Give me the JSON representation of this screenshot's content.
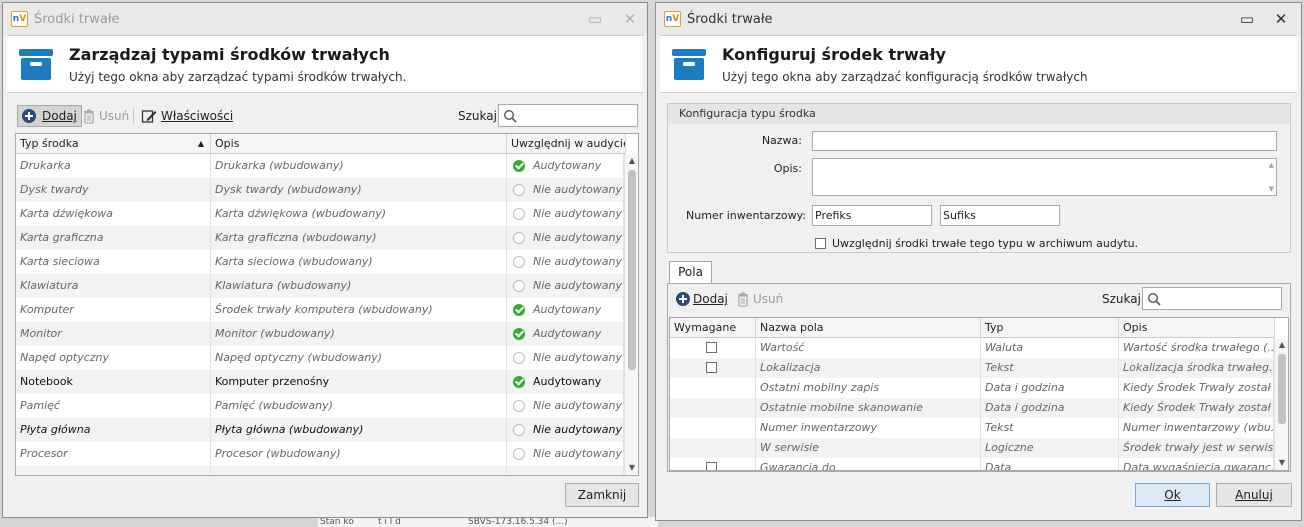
{
  "background": {
    "strip_texts": [
      "Stan ko",
      "t i l d",
      "SBVS-173.16.5.34 (...)"
    ]
  },
  "left_window": {
    "title": "Środki trwałe",
    "controls": {
      "maximize": "▭",
      "close": "✕"
    },
    "header": {
      "title": "Zarządzaj typami środków trwałych",
      "subtitle": "Użyj tego okna aby zarządzać typami środków trwałych."
    },
    "toolbar": {
      "add_label": "Dodaj",
      "remove_label": "Usuń",
      "properties_label": "Właściwości",
      "search_label": "Szukaj"
    },
    "grid": {
      "columns": [
        "Typ środka",
        "Opis",
        "Uwzględnij w audycie"
      ],
      "sort_indicator": "▲",
      "rows": [
        {
          "type": "Drukarka",
          "desc": "Drukarka (wbudowany)",
          "audit": "Audytowany",
          "audited": true,
          "style": "it"
        },
        {
          "type": "Dysk twardy",
          "desc": "Dysk twardy (wbudowany)",
          "audit": "Nie audytowany",
          "audited": false,
          "style": "it"
        },
        {
          "type": "Karta dźwiękowa",
          "desc": "Karta dźwiękowa (wbudowany)",
          "audit": "Nie audytowany",
          "audited": false,
          "style": "it"
        },
        {
          "type": "Karta graficzna",
          "desc": "Karta graficzna (wbudowany)",
          "audit": "Nie audytowany",
          "audited": false,
          "style": "it"
        },
        {
          "type": "Karta sieciowa",
          "desc": "Karta sieciowa (wbudowany)",
          "audit": "Nie audytowany",
          "audited": false,
          "style": "it"
        },
        {
          "type": "Klawiatura",
          "desc": "Klawiatura (wbudowany)",
          "audit": "Nie audytowany",
          "audited": false,
          "style": "it"
        },
        {
          "type": "Komputer",
          "desc": "Środek trwały komputera (wbudowany)",
          "audit": "Audytowany",
          "audited": true,
          "style": "it"
        },
        {
          "type": "Monitor",
          "desc": "Monitor (wbudowany)",
          "audit": "Audytowany",
          "audited": true,
          "style": "it"
        },
        {
          "type": "Napęd optyczny",
          "desc": "Napęd optyczny (wbudowany)",
          "audit": "Nie audytowany",
          "audited": false,
          "style": "it"
        },
        {
          "type": "Notebook",
          "desc": "Komputer przenośny",
          "audit": "Audytowany",
          "audited": true,
          "style": "bold"
        },
        {
          "type": "Pamięć",
          "desc": "Pamięć (wbudowany)",
          "audit": "Nie audytowany",
          "audited": false,
          "style": "it"
        },
        {
          "type": "Płyta główna",
          "desc": "Płyta główna (wbudowany)",
          "audit": "Nie audytowany",
          "audited": false,
          "style": "bi"
        },
        {
          "type": "Procesor",
          "desc": "Procesor (wbudowany)",
          "audit": "Nie audytowany",
          "audited": false,
          "style": "it"
        },
        {
          "type": "",
          "desc": "",
          "audit": "",
          "audited": false,
          "style": "it"
        }
      ]
    },
    "close_button": "Zamknij"
  },
  "right_window": {
    "title": "Środki trwałe",
    "controls": {
      "maximize": "▭",
      "close": "✕"
    },
    "header": {
      "title": "Konfiguruj środek trwały",
      "subtitle": "Użyj tego okna aby zarządzać konfiguracją środków trwałych"
    },
    "config_group": {
      "title": "Konfiguracja typu środka",
      "name_label": "Nazwa:",
      "name_value": "",
      "desc_label": "Opis:",
      "desc_value": "",
      "inventory_label": "Numer inwentarzowy:",
      "prefix_value": "Prefiks",
      "suffix_value": "Sufiks",
      "archive_checkbox_label": "Uwzględnij środki trwałe tego typu w archiwum audytu."
    },
    "tabs": [
      "Pola"
    ],
    "fields_toolbar": {
      "add_label": "Dodaj",
      "remove_label": "Usuń",
      "search_label": "Szukaj"
    },
    "fields_grid": {
      "columns": [
        "Wymagane",
        "Nazwa pola",
        "Typ",
        "Opis"
      ],
      "rows": [
        {
          "required_box": true,
          "name": "Wartość",
          "type": "Waluta",
          "desc": "Wartość środka trwałego (..."
        },
        {
          "required_box": true,
          "name": "Lokalizacja",
          "type": "Tekst",
          "desc": "Lokalizacja środka trwałeg..."
        },
        {
          "required_box": false,
          "name": "Ostatni mobilny zapis",
          "type": "Data i godzina",
          "desc": "Kiedy Środek Trwały został ..."
        },
        {
          "required_box": false,
          "name": "Ostatnie mobilne skanowanie",
          "type": "Data i godzina",
          "desc": "Kiedy Środek Trwały został ..."
        },
        {
          "required_box": false,
          "name": "Numer inwentarzowy",
          "type": "Tekst",
          "desc": "Numer inwentarzowy (wbu..."
        },
        {
          "required_box": false,
          "name": "W serwisie",
          "type": "Logiczne",
          "desc": "Środek trwały jest w serwis..."
        },
        {
          "required_box": true,
          "name": "Gwarancja do",
          "type": "Data",
          "desc": "Data wygaśnięcia gwaranc..."
        }
      ]
    },
    "ok_button": "Ok",
    "cancel_button": "Anuluj"
  },
  "colors": {
    "audited_green": "#2fae2f",
    "header_icon_blue": "#1e7bbf"
  }
}
